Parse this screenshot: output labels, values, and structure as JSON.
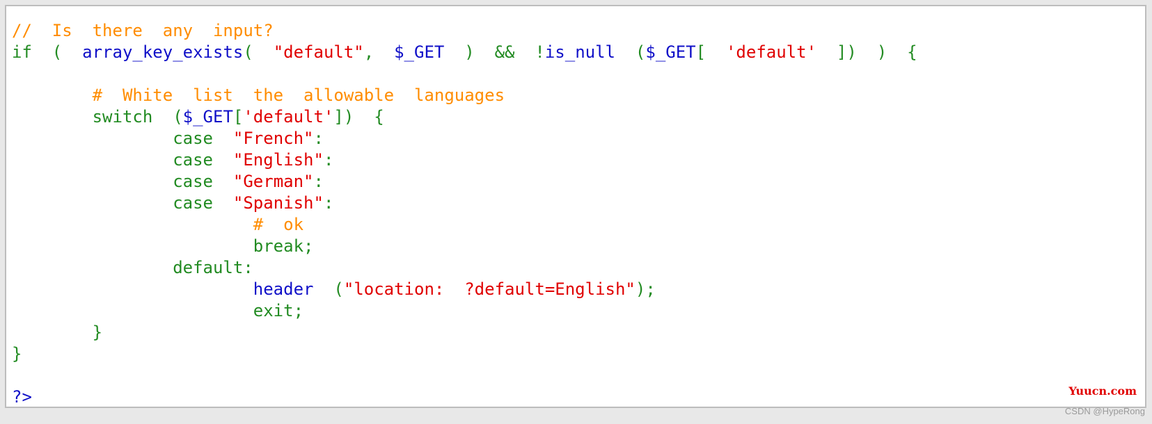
{
  "editor": {
    "lines": [
      [
        {
          "t": "//  Is  there  any  input?",
          "k": "comment"
        }
      ],
      [
        {
          "t": "if  (  ",
          "k": "keyword"
        },
        {
          "t": "array_key_exists",
          "k": "func"
        },
        {
          "t": "(  ",
          "k": "punct"
        },
        {
          "t": "\"default\"",
          "k": "string"
        },
        {
          "t": ",  ",
          "k": "punct"
        },
        {
          "t": "$_GET",
          "k": "var"
        },
        {
          "t": "  )  &&  !",
          "k": "punct"
        },
        {
          "t": "is_null",
          "k": "func"
        },
        {
          "t": "  (",
          "k": "punct"
        },
        {
          "t": "$_GET",
          "k": "var"
        },
        {
          "t": "[  ",
          "k": "punct"
        },
        {
          "t": "'default'",
          "k": "string"
        },
        {
          "t": "  ])  )  {",
          "k": "punct"
        }
      ],
      [
        {
          "t": "",
          "k": "punct"
        }
      ],
      [
        {
          "t": "        #  White  list  the  allowable  languages",
          "k": "comment"
        }
      ],
      [
        {
          "t": "        switch  (",
          "k": "keyword"
        },
        {
          "t": "$_GET",
          "k": "var"
        },
        {
          "t": "[",
          "k": "punct"
        },
        {
          "t": "'default'",
          "k": "string"
        },
        {
          "t": "])  {",
          "k": "punct"
        }
      ],
      [
        {
          "t": "                case  ",
          "k": "keyword"
        },
        {
          "t": "\"French\"",
          "k": "string"
        },
        {
          "t": ":",
          "k": "punct"
        }
      ],
      [
        {
          "t": "                case  ",
          "k": "keyword"
        },
        {
          "t": "\"English\"",
          "k": "string"
        },
        {
          "t": ":",
          "k": "punct"
        }
      ],
      [
        {
          "t": "                case  ",
          "k": "keyword"
        },
        {
          "t": "\"German\"",
          "k": "string"
        },
        {
          "t": ":",
          "k": "punct"
        }
      ],
      [
        {
          "t": "                case  ",
          "k": "keyword"
        },
        {
          "t": "\"Spanish\"",
          "k": "string"
        },
        {
          "t": ":",
          "k": "punct"
        }
      ],
      [
        {
          "t": "                        #  ok",
          "k": "comment"
        }
      ],
      [
        {
          "t": "                        break;",
          "k": "keyword"
        }
      ],
      [
        {
          "t": "                default:",
          "k": "keyword"
        }
      ],
      [
        {
          "t": "                        ",
          "k": "punct"
        },
        {
          "t": "header",
          "k": "func"
        },
        {
          "t": "  (",
          "k": "punct"
        },
        {
          "t": "\"location:  ?default=English\"",
          "k": "string"
        },
        {
          "t": ");",
          "k": "punct"
        }
      ],
      [
        {
          "t": "                        exit;",
          "k": "keyword"
        }
      ],
      [
        {
          "t": "        }",
          "k": "punct"
        }
      ],
      [
        {
          "t": "}",
          "k": "punct"
        }
      ],
      [
        {
          "t": "",
          "k": "punct"
        }
      ],
      [
        {
          "t": "?>",
          "k": "func"
        }
      ]
    ]
  },
  "watermark": "Yuucn.com",
  "credit": "CSDN @HypeRong",
  "colors": {
    "comment": "#ff8c00",
    "keyword": "#228b22",
    "function": "#1010c8",
    "string": "#e00000",
    "background": "#ffffff"
  }
}
